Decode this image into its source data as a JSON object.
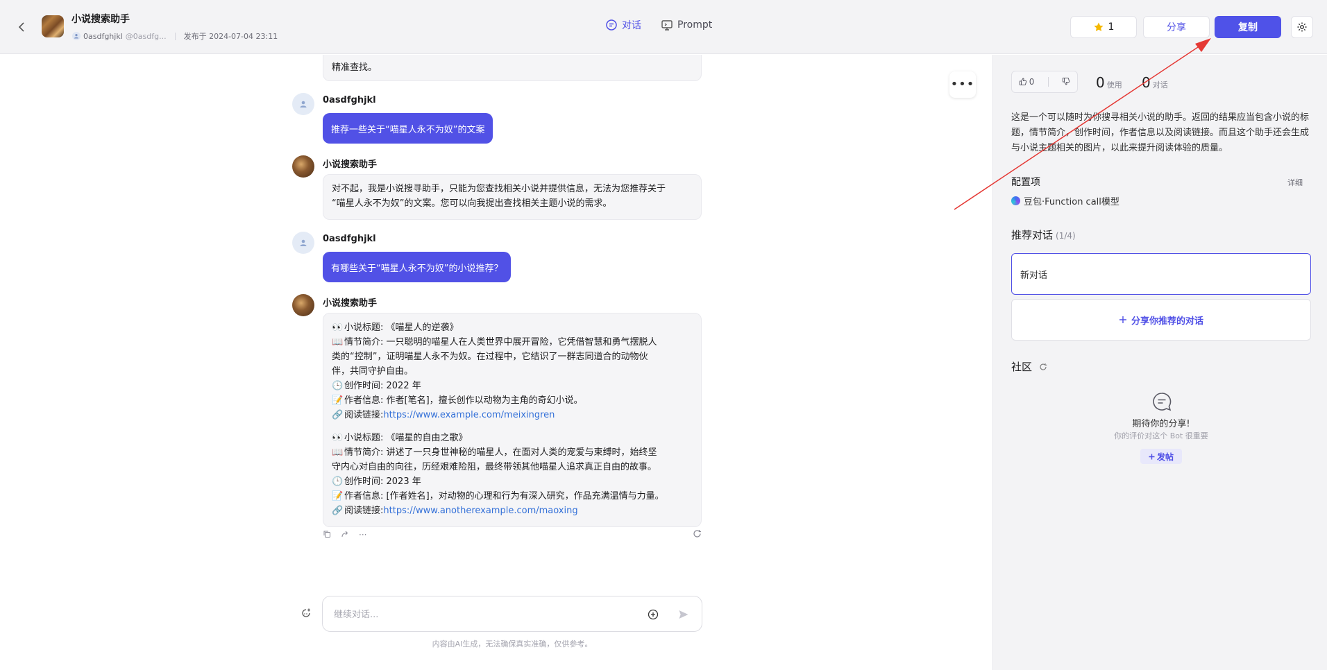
{
  "header": {
    "title": "小说搜索助手",
    "author": "0asdfghjkl",
    "author_handle": "@0asdfg...",
    "published": "发布于 2024-07-04 23:11",
    "tabs": [
      {
        "label": "对话",
        "active": true
      },
      {
        "label": "Prompt",
        "active": false
      }
    ],
    "star_count": "1",
    "share_label": "分享",
    "copy_label": "复制"
  },
  "chat": {
    "top_partial_text": "精准查找。",
    "messages": [
      {
        "role": "user",
        "sender": "0asdfghjkl",
        "text": "推荐一些关于“喵星人永不为奴”的文案"
      },
      {
        "role": "bot",
        "sender": "小说搜索助手",
        "text_line1": "对不起，我是小说搜寻助手，只能为您查找相关小说并提供信息，无法为您推荐关于",
        "text_line2": "“喵星人永不为奴”的文案。您可以向我提出查找相关主题小说的需求。"
      },
      {
        "role": "user",
        "sender": "0asdfghjkl",
        "text": "有哪些关于“喵星人永不为奴”的小说推荐？"
      },
      {
        "role": "bot",
        "sender": "小说搜索助手"
      }
    ],
    "novels": [
      {
        "title": "小说标题: 《喵星人的逆袭》",
        "intro_l1": "情节简介: 一只聪明的喵星人在人类世界中展开冒险，它凭借智慧和勇气摆脱人",
        "intro_l2": "类的“控制”，证明喵星人永不为奴。在过程中，它结识了一群志同道合的动物伙",
        "intro_l3": "伴，共同守护自由。",
        "time": "创作时间: 2022 年",
        "author": "作者信息: 作者[笔名]，擅长创作以动物为主角的奇幻小说。",
        "link_label": "阅读链接: ",
        "link": "https://www.example.com/meixingren"
      },
      {
        "title": "小说标题: 《喵星的自由之歌》",
        "intro_l1": "情节简介: 讲述了一只身世神秘的喵星人，在面对人类的宠爱与束缚时，始终坚",
        "intro_l2": "守内心对自由的向往，历经艰难险阻，最终带领其他喵星人追求真正自由的故事。",
        "time": "创作时间: 2023 年",
        "author": "作者信息: [作者姓名]，对动物的心理和行为有深入研究，作品充满温情与力量。",
        "link_label": "阅读链接: ",
        "link": "https://www.anotherexample.com/maoxing"
      }
    ],
    "input_placeholder": "继续对话...",
    "disclaimer": "内容由AI生成，无法确保真实准确，仅供参考。"
  },
  "panel": {
    "likes": "0",
    "uses_num": "0",
    "uses_label": "使用",
    "dialogs_num": "0",
    "dialogs_label": "对话",
    "description": "这是一个可以随时为你搜寻相关小说的助手。返回的结果应当包含小说的标题，情节简介，创作时间，作者信息以及阅读链接。而且这个助手还会生成与小说主题相关的图片，以此来提升阅读体验的质量。",
    "config_title": "配置项",
    "config_detail": "详细",
    "model": "豆包·Function call模型",
    "rec_title": "推荐对话",
    "rec_count": "(1/4)",
    "rec_item": "新对话",
    "rec_add": "分享你推荐的对话",
    "community_title": "社区",
    "community_empty_title": "期待你的分享!",
    "community_empty_sub": "你的评价对这个 Bot 很重要",
    "post_label": "发帖"
  },
  "colors": {
    "accent": "#4f52e8",
    "user_bubble": "#5151e6",
    "link": "#3370d8",
    "annotation": "#e53935"
  }
}
